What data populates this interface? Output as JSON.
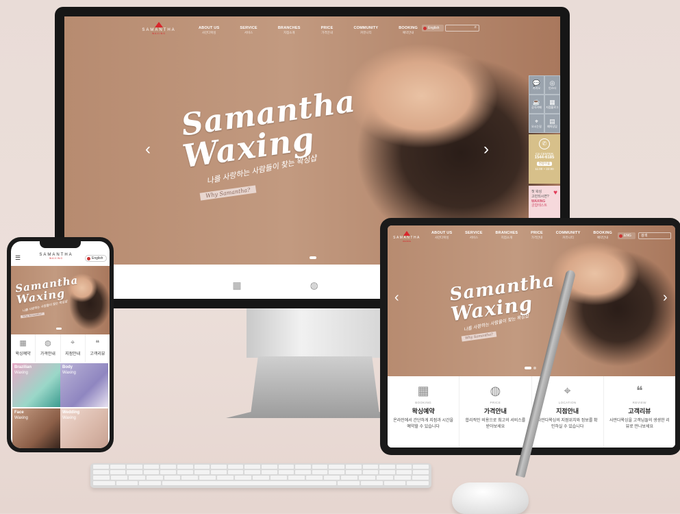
{
  "desktop": {
    "logo": {
      "name": "SAMANTHA",
      "sub": "WAXING"
    },
    "nav": [
      {
        "en": "ABOUT US",
        "kr": "사만다왁싱"
      },
      {
        "en": "SERVICE",
        "kr": "서비스"
      },
      {
        "en": "BRANCHES",
        "kr": "지점소개"
      },
      {
        "en": "PRICE",
        "kr": "가격안내"
      },
      {
        "en": "COMMUNITY",
        "kr": "커뮤니티"
      },
      {
        "en": "BOOKING",
        "kr": "예약안내"
      }
    ],
    "lang": "English",
    "search_icon": "search-icon",
    "hero": {
      "line1": "Samantha",
      "line2": "Waxing",
      "kr_tag": "나를 사랑하는 사람들이 찾는 왁싱샵",
      "why": "Why Samantha?"
    },
    "quick_menu": [
      {
        "icon": "chat-icon",
        "label": "카카오"
      },
      {
        "icon": "instagram-icon",
        "label": "인스타"
      },
      {
        "icon": "coffee-icon",
        "label": "공식카페"
      },
      {
        "icon": "blog-icon",
        "label": "지점블로그"
      },
      {
        "icon": "location-icon",
        "label": "오시는길"
      },
      {
        "icon": "calendar-icon",
        "label": "예약상담"
      }
    ],
    "cs": {
      "title": "CS CENTER",
      "phone": "1544-6185",
      "badge": "연중무휴",
      "hours": "11:00 ~ 22:00"
    },
    "event": {
      "line1": "첫 왁싱",
      "line2": "고민되시면?",
      "line3": "WAXING",
      "line4": "궁합테스트"
    }
  },
  "tablet": {
    "logo": {
      "name": "SAMANTHA",
      "sub": "WAXING"
    },
    "nav": [
      {
        "en": "ABOUT US",
        "kr": "사만다왁싱"
      },
      {
        "en": "SERVICE",
        "kr": "서비스"
      },
      {
        "en": "BRANCHES",
        "kr": "지점소개"
      },
      {
        "en": "PRICE",
        "kr": "가격안내"
      },
      {
        "en": "COMMUNITY",
        "kr": "커뮤니티"
      },
      {
        "en": "BOOKING",
        "kr": "예약안내"
      }
    ],
    "lang": "ENG",
    "search_label": "검색",
    "hero": {
      "line1": "Samantha",
      "line2": "Waxing",
      "kr_tag": "나를 사랑하는 사람들이 찾는 왁싱샵",
      "why": "Why Samantha?"
    },
    "features": [
      {
        "icon": "calendar-icon",
        "en": "BOOKING",
        "kr": "왁싱예약",
        "desc": "온라인에서 간단하게 지점과 시간을 예약할 수 있습니다"
      },
      {
        "icon": "price-icon",
        "en": "PRICE",
        "kr": "가격안내",
        "desc": "합리적인 비용으로 최고의 서비스를 받아보세요"
      },
      {
        "icon": "location-icon",
        "en": "LOCATION",
        "kr": "지점안내",
        "desc": "사만다왁싱의 지점위치와 정보를 확인하실 수 있습니다"
      },
      {
        "icon": "review-icon",
        "en": "REVIEW",
        "kr": "고객리뷰",
        "desc": "사만다왁싱을 고객님들의 생생한 리뷰로 만나보세요"
      }
    ]
  },
  "phone": {
    "logo": {
      "name": "SAMANTHA",
      "sub": "WAXING"
    },
    "lang": "English",
    "hero": {
      "line1": "Samantha",
      "line2": "Waxing",
      "kr_tag": "나를 사랑하는 사람들이 찾는 왁싱샵",
      "why": "Why Samantha?"
    },
    "quick": [
      {
        "icon": "calendar-icon",
        "label": "왁싱예약"
      },
      {
        "icon": "price-icon",
        "label": "가격안내"
      },
      {
        "icon": "location-icon",
        "label": "지점안내"
      },
      {
        "icon": "review-icon",
        "label": "고객리뷰"
      }
    ],
    "tiles": [
      {
        "t1": "Brazilian",
        "t2": "Waxing"
      },
      {
        "t1": "Body",
        "t2": "Waxing"
      },
      {
        "t1": "Face",
        "t2": "Waxing"
      },
      {
        "t1": "Wedding",
        "t2": "Waxing"
      }
    ]
  },
  "colors": {
    "brand_red": "#d8262c",
    "hero_tan": "#b98e73",
    "pink_event": "#f6d9dc"
  }
}
